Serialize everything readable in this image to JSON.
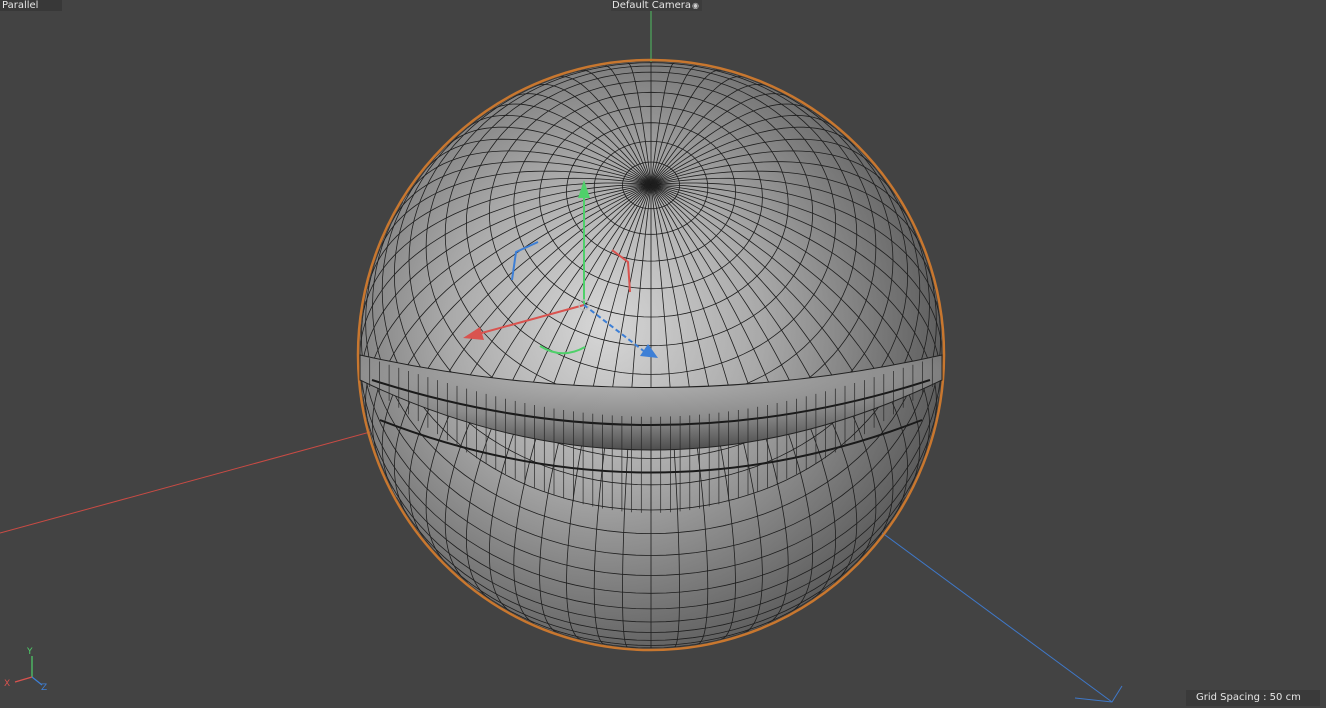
{
  "viewport": {
    "projection_label": "Parallel",
    "camera_label": "Default Camera",
    "camera_icon": "camera-eye-icon",
    "grid_spacing_label": "Grid Spacing : 50 cm"
  },
  "axis_widget": {
    "x": "X",
    "y": "Y",
    "z": "Z"
  },
  "colors": {
    "background": "#434343",
    "x_axis": "#d9534f",
    "y_axis": "#4fd06a",
    "z_axis": "#3d7fd6",
    "selection_outline": "#c8772f",
    "mesh_wire": "#1e1e1e"
  },
  "scene": {
    "object": "sphere",
    "selected": true,
    "latitude_segments": 32,
    "longitude_segments": 64
  }
}
